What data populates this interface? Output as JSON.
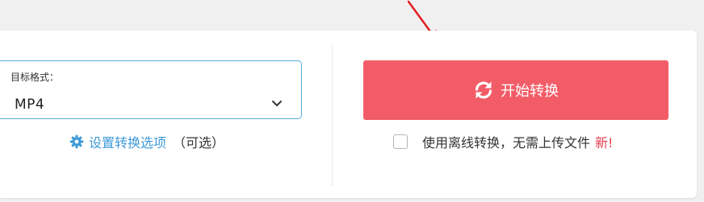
{
  "format": {
    "label": "目标格式：",
    "value": "MP4"
  },
  "settings": {
    "link_text": "设置转换选项",
    "optional_text": "（可选）",
    "icon": "gear-icon"
  },
  "convert": {
    "button_label": "开始转换",
    "icon": "refresh-icon"
  },
  "offline": {
    "label": "使用离线转换，无需上传文件",
    "new_badge": "新!",
    "checked": false
  },
  "colors": {
    "accent_button": "#f25c67",
    "link": "#3d9ad8",
    "focus_border": "#5aaedc",
    "new_badge": "#e8414d",
    "annotation_arrow": "#e02020"
  }
}
